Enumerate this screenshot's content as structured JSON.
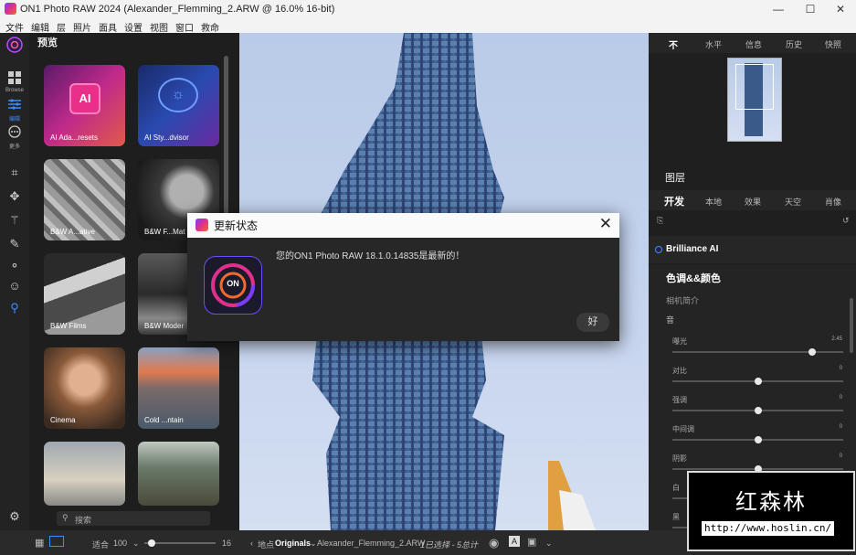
{
  "window": {
    "title": "ON1 Photo RAW 2024 (Alexander_Flemming_2.ARW @ 16.0% 16-bit)",
    "minimize": "—",
    "maximize": "☐",
    "close": "✕"
  },
  "menu": [
    "文件",
    "编辑",
    "层",
    "照片",
    "面具",
    "设置",
    "视图",
    "窗口",
    "救命"
  ],
  "tools": {
    "browse_label": "Browse",
    "edit_label": "编辑",
    "more_label": "更多"
  },
  "browser": {
    "title": "预览",
    "presets": [
      {
        "label": "AI Ada...resets",
        "icon": "AI"
      },
      {
        "label": "AI Sty...dvisor",
        "icon": "chat-bulb"
      },
      {
        "label": "B&W A...ative"
      },
      {
        "label": "B&W F...Mat"
      },
      {
        "label": "B&W Films"
      },
      {
        "label": "B&W Moder"
      },
      {
        "label": "Cinema"
      },
      {
        "label": "Cold ...ntain"
      },
      {
        "label": ""
      },
      {
        "label": ""
      }
    ],
    "search_placeholder": "搜索"
  },
  "bottom": {
    "fit_label": "适合",
    "zoom_value": "100",
    "zoom_max": "16",
    "location_label": "地点",
    "folder": "Originals",
    "filename": "Alexander_Flemming_2.ARW",
    "selection": "1已选择 - 5总计"
  },
  "right": {
    "top_tabs": [
      "不",
      "水平",
      "信息",
      "历史",
      "快照"
    ],
    "layers_title": "图层",
    "module_tabs": [
      "开发",
      "本地",
      "效果",
      "天空",
      "肖像"
    ],
    "brilliance": "Brilliance AI",
    "section_title": "色调&&颜色",
    "profile_label": "相机简介",
    "tone_label": "音",
    "adjustments": [
      {
        "label": "曝光",
        "value": "2.45",
        "position": 0.82
      },
      {
        "label": "对比",
        "value": "0",
        "position": 0.5
      },
      {
        "label": "强调",
        "value": "0",
        "position": 0.5
      },
      {
        "label": "中间调",
        "value": "0",
        "position": 0.5
      },
      {
        "label": "阴影",
        "value": "0",
        "position": 0.5
      },
      {
        "label": "白",
        "value": "",
        "position": 0.5
      },
      {
        "label": "黑",
        "value": "",
        "position": 0.5
      }
    ]
  },
  "dialog": {
    "title": "更新状态",
    "message": "您的ON1 Photo RAW 18.1.0.14835是最新的！",
    "ok": "好",
    "logo_text": "ON"
  },
  "watermark": {
    "text": "红森林",
    "url": "http://www.hoslin.cn/"
  },
  "colors": {
    "accent": "#3a8fff",
    "panel": "#1f1f1f",
    "dialog_bg": "#272727"
  }
}
